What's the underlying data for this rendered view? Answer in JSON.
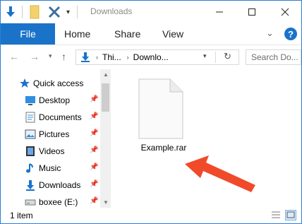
{
  "window": {
    "title": "Downloads"
  },
  "ribbon": {
    "file_tab": "File",
    "tabs": [
      "Home",
      "Share",
      "View"
    ]
  },
  "address": {
    "crumbs": [
      "Thi...",
      "Downlo..."
    ],
    "search_placeholder": "Search Do..."
  },
  "navpane": {
    "items": [
      {
        "label": "Quick access",
        "icon": "star-icon",
        "pinned": false
      },
      {
        "label": "Desktop",
        "icon": "desktop-icon",
        "pinned": true
      },
      {
        "label": "Documents",
        "icon": "documents-icon",
        "pinned": true
      },
      {
        "label": "Pictures",
        "icon": "pictures-icon",
        "pinned": true
      },
      {
        "label": "Videos",
        "icon": "videos-icon",
        "pinned": true
      },
      {
        "label": "Music",
        "icon": "music-icon",
        "pinned": true
      },
      {
        "label": "Downloads",
        "icon": "downloads-icon",
        "pinned": true
      },
      {
        "label": "boxee (E:)",
        "icon": "drive-icon",
        "pinned": true
      }
    ]
  },
  "content": {
    "files": [
      {
        "name": "Example.rar",
        "icon": "blank-file-icon"
      }
    ]
  },
  "status": {
    "item_count": "1 item"
  },
  "colors": {
    "accent": "#1a73c9",
    "arrow": "#f04a2a"
  }
}
